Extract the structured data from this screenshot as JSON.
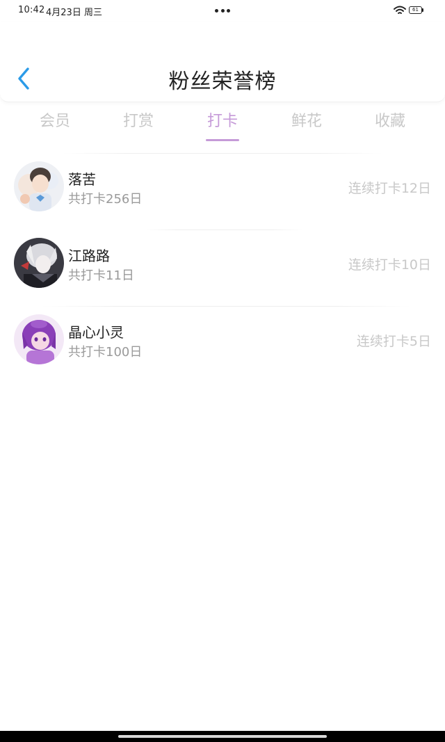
{
  "status_bar": {
    "time": "10:42",
    "date": "4月23日 周三",
    "battery": "61",
    "icons": [
      "more-dots-icon",
      "wifi-icon",
      "battery-icon"
    ]
  },
  "header": {
    "title": "粉丝荣誉榜",
    "back_icon": "chevron-left-icon",
    "accent_color": "#2b9be8"
  },
  "tabs": {
    "active_index": 2,
    "active_color": "#c59ad8",
    "items": [
      {
        "label": "会员"
      },
      {
        "label": "打赏"
      },
      {
        "label": "打卡"
      },
      {
        "label": "鲜花"
      },
      {
        "label": "收藏"
      }
    ]
  },
  "list": {
    "items": [
      {
        "name": "落苦",
        "total": "共打卡256日",
        "streak": "连续打卡12日"
      },
      {
        "name": "江路路",
        "total": "共打卡11日",
        "streak": "连续打卡10日"
      },
      {
        "name": "晶心小灵",
        "total": "共打卡100日",
        "streak": "连续打卡5日"
      }
    ]
  }
}
